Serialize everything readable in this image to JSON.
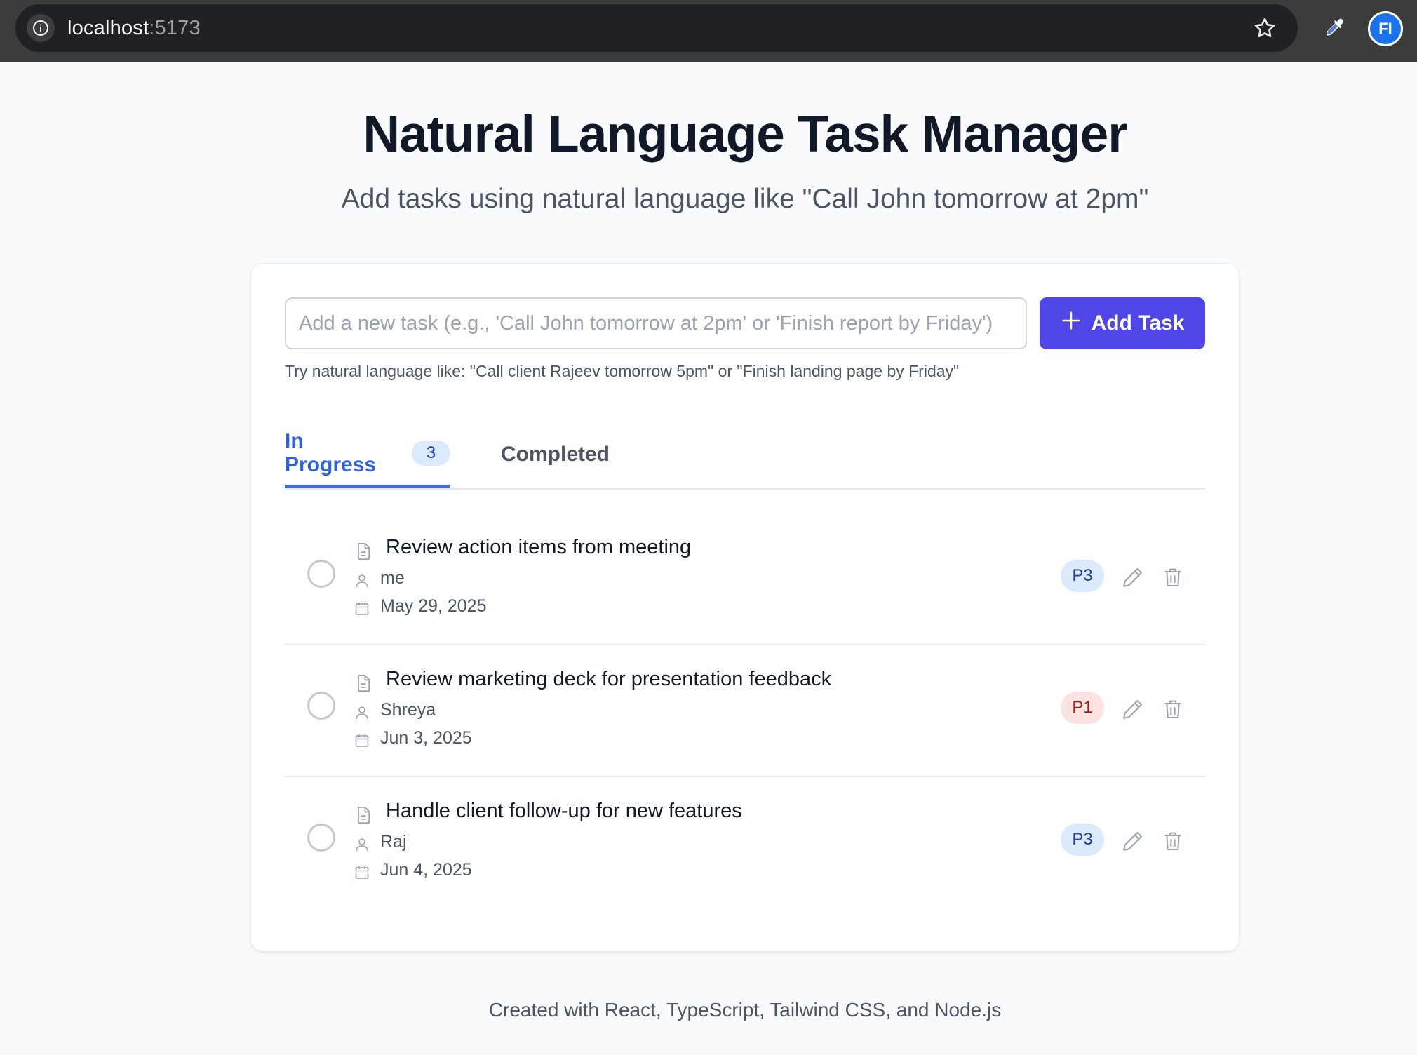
{
  "browser": {
    "url_host": "localhost",
    "url_port": ":5173",
    "extension_label": "FI"
  },
  "header": {
    "title": "Natural Language Task Manager",
    "subtitle": "Add tasks using natural language like \"Call John tomorrow at 2pm\""
  },
  "composer": {
    "placeholder": "Add a new task (e.g., 'Call John tomorrow at 2pm' or 'Finish report by Friday')",
    "value": "",
    "add_button_label": "Add Task",
    "hint": "Try natural language like: \"Call client Rajeev tomorrow 5pm\" or \"Finish landing page by Friday\""
  },
  "tabs": [
    {
      "label": "In Progress",
      "count": "3",
      "active": true
    },
    {
      "label": "Completed",
      "active": false
    }
  ],
  "tasks": [
    {
      "title": "Review action items from meeting",
      "assignee": "me",
      "due": "May 29, 2025",
      "priority": "P3"
    },
    {
      "title": "Review marketing deck for presentation feedback",
      "assignee": "Shreya",
      "due": "Jun 3, 2025",
      "priority": "P1"
    },
    {
      "title": "Handle client follow-up for new features",
      "assignee": "Raj",
      "due": "Jun 4, 2025",
      "priority": "P3"
    }
  ],
  "colors": {
    "accent": "#4f46e5",
    "active_tab": "#2f62d8",
    "p3_badge_bg": "#dbeafe",
    "p1_badge_bg": "#fde2e2"
  },
  "icons": [
    "info-icon",
    "star-icon",
    "eyedropper-icon",
    "plus-icon",
    "document-icon",
    "user-icon",
    "calendar-icon",
    "pencil-icon",
    "trash-icon"
  ],
  "footer": {
    "text": "Created with React, TypeScript, Tailwind CSS, and Node.js"
  }
}
